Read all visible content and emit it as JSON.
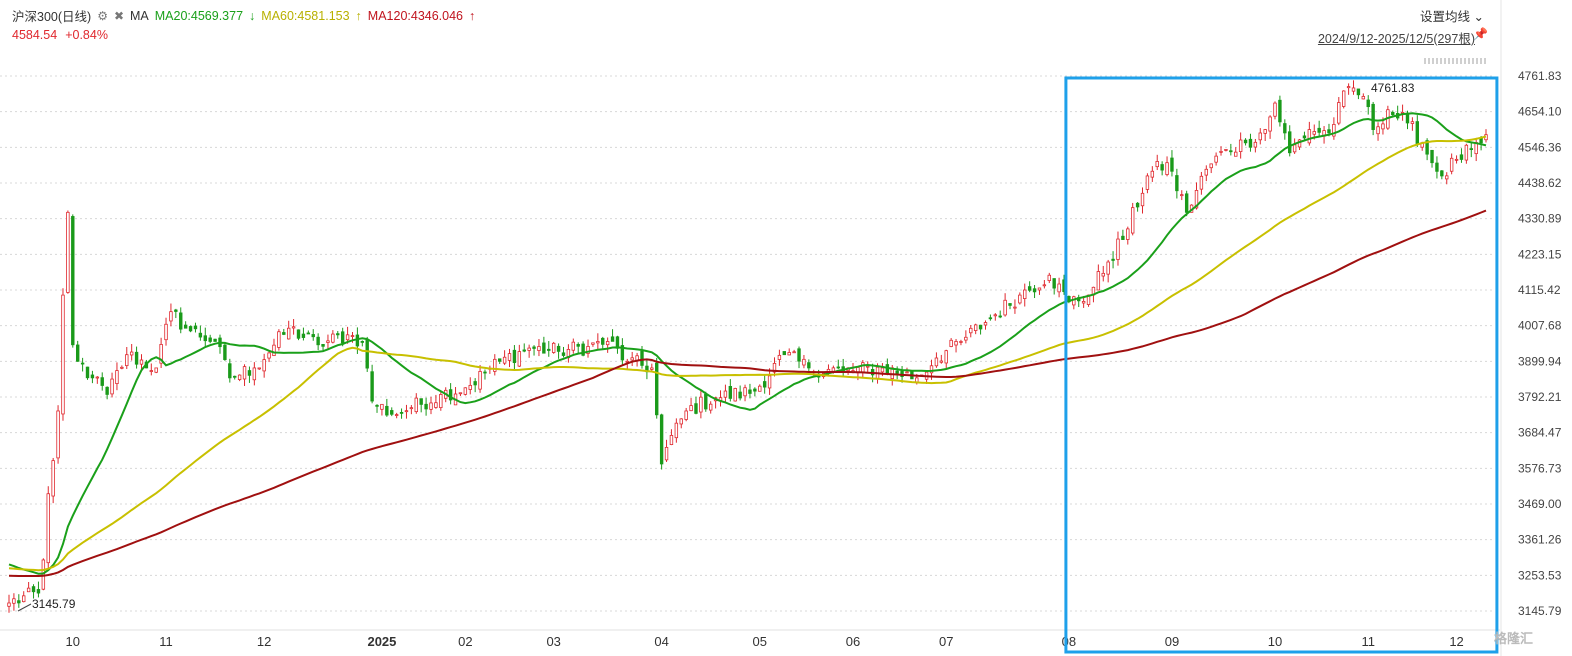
{
  "header": {
    "name": "沪深300(日线)",
    "indicator": "MA",
    "ma20": "MA20:4569.377",
    "ma20_arrow": "↓",
    "ma60": "MA60:4581.153",
    "ma60_arrow": "↑",
    "ma120": "MA120:4346.046",
    "ma120_arrow": "↑",
    "price": "4584.54",
    "change": "+0.84%",
    "settings_label": "设置均线",
    "date_range": "2024/9/12-2025/12/5(297根)"
  },
  "colors": {
    "up": "#e0282e",
    "down": "#1a9a1a",
    "ma20": "#1aa01a",
    "ma60": "#c8c000",
    "ma120": "#a01010",
    "highlight": "#1ea0ea"
  },
  "watermark": "格隆汇",
  "chart_data": {
    "type": "candlestick",
    "y_ticks": [
      "4761.83",
      "4654.10",
      "4546.36",
      "4438.62",
      "4330.89",
      "4223.15",
      "4115.42",
      "4007.68",
      "3899.94",
      "3792.21",
      "3684.47",
      "3576.73",
      "3469.00",
      "3361.26",
      "3253.53",
      "3145.79"
    ],
    "ylim": [
      3145.79,
      4761.83
    ],
    "x_tick_labels": [
      "10",
      "11",
      "12",
      "2025",
      "02",
      "03",
      "04",
      "05",
      "06",
      "07",
      "08",
      "09",
      "10",
      "11",
      "12"
    ],
    "x_tick_index": [
      13,
      32,
      52,
      76,
      93,
      111,
      133,
      153,
      172,
      191,
      216,
      237,
      258,
      277,
      295
    ],
    "high_label": "4761.83",
    "low_label": "3145.79",
    "highlight_range_index": [
      216,
      302
    ],
    "close_anchors": [
      [
        0,
        3170
      ],
      [
        6,
        3200
      ],
      [
        7,
        3300
      ],
      [
        8,
        3500
      ],
      [
        9,
        3600
      ],
      [
        10,
        3750
      ],
      [
        11,
        4100
      ],
      [
        12,
        4350
      ],
      [
        13,
        3950
      ],
      [
        14,
        3900
      ],
      [
        17,
        3850
      ],
      [
        20,
        3800
      ],
      [
        24,
        3920
      ],
      [
        30,
        3880
      ],
      [
        33,
        4050
      ],
      [
        36,
        4000
      ],
      [
        42,
        3960
      ],
      [
        45,
        3850
      ],
      [
        50,
        3880
      ],
      [
        57,
        4000
      ],
      [
        63,
        3950
      ],
      [
        69,
        3980
      ],
      [
        72,
        3960
      ],
      [
        74,
        3780
      ],
      [
        78,
        3740
      ],
      [
        82,
        3760
      ],
      [
        88,
        3800
      ],
      [
        93,
        3820
      ],
      [
        100,
        3900
      ],
      [
        106,
        3940
      ],
      [
        112,
        3930
      ],
      [
        118,
        3945
      ],
      [
        122,
        3960
      ],
      [
        126,
        3900
      ],
      [
        131,
        3880
      ],
      [
        133,
        3590
      ],
      [
        134,
        3640
      ],
      [
        138,
        3750
      ],
      [
        144,
        3790
      ],
      [
        152,
        3810
      ],
      [
        158,
        3920
      ],
      [
        163,
        3880
      ],
      [
        170,
        3870
      ],
      [
        178,
        3880
      ],
      [
        185,
        3850
      ],
      [
        189,
        3910
      ],
      [
        194,
        3960
      ],
      [
        200,
        4030
      ],
      [
        206,
        4100
      ],
      [
        212,
        4160
      ],
      [
        216,
        4080
      ],
      [
        220,
        4100
      ],
      [
        224,
        4200
      ],
      [
        228,
        4300
      ],
      [
        232,
        4460
      ],
      [
        236,
        4500
      ],
      [
        240,
        4350
      ],
      [
        244,
        4480
      ],
      [
        248,
        4540
      ],
      [
        252,
        4560
      ],
      [
        256,
        4600
      ],
      [
        258,
        4680
      ],
      [
        261,
        4530
      ],
      [
        265,
        4600
      ],
      [
        269,
        4590
      ],
      [
        273,
        4730
      ],
      [
        276,
        4700
      ],
      [
        278,
        4600
      ],
      [
        281,
        4660
      ],
      [
        285,
        4620
      ],
      [
        288,
        4560
      ],
      [
        290,
        4500
      ],
      [
        292,
        4460
      ],
      [
        295,
        4510
      ],
      [
        298,
        4540
      ],
      [
        300,
        4560
      ],
      [
        301,
        4584.54
      ]
    ]
  }
}
